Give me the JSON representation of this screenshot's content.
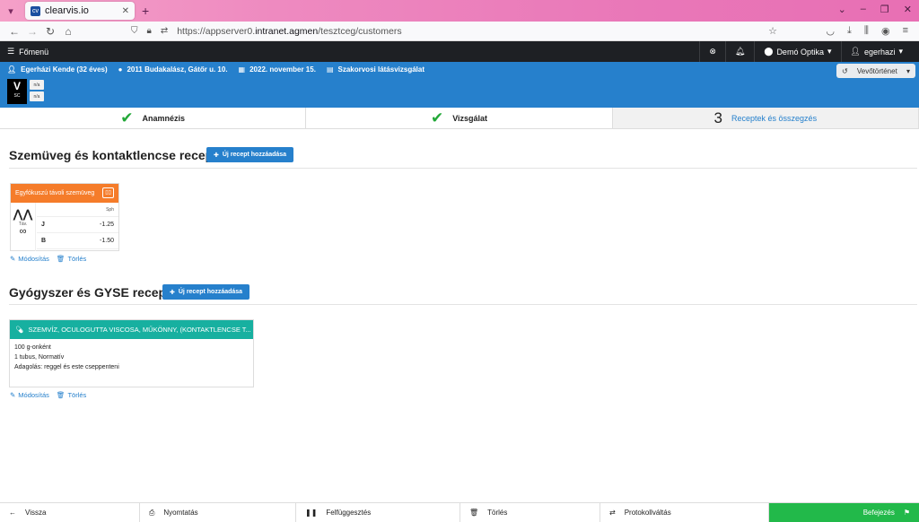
{
  "browser": {
    "tab_title": "clearvis.io",
    "favicon_text": "cv",
    "url_prefix": "https://appserver0.",
    "url_host": "intranet.agmen",
    "url_path": "/tesztceg/customers"
  },
  "appbar": {
    "menu_label": "Főmenü",
    "location": "Demó Optika",
    "user": "egerhazi"
  },
  "patient": {
    "name": "Egerházi Kende (32 éves)",
    "address": "2011 Budakalász, Gátőr u. 10.",
    "date": "2022. november 15.",
    "exam_type": "Szakorvosi látásvizsgálat",
    "history_button": "Vevőtörténet",
    "logo_big": "V",
    "logo_small": "SC",
    "na1": "n/a",
    "na2": "n/a"
  },
  "steps": [
    {
      "label": "Anamnézis"
    },
    {
      "label": "Vizsgálat"
    },
    {
      "num": "3",
      "label": "Receptek és összegzés"
    }
  ],
  "glasses_section": {
    "title": "Szemüveg és kontaktlencse receptek",
    "add_button": "Új recept hozzáadása",
    "card": {
      "header": "Egyfókuszú távoli szemüveg",
      "distance_label": "Táv.",
      "column_header": "Sph",
      "rows": [
        {
          "eye": "J",
          "sph": "-1.25"
        },
        {
          "eye": "B",
          "sph": "-1.50"
        }
      ]
    },
    "edit_link": "Módosítás",
    "delete_link": "Törlés"
  },
  "medicine_section": {
    "title": "Gyógyszer és GYSE receptek",
    "add_button": "Új recept hozzáadása",
    "card": {
      "header": "SZEMVÍZ, OCULOGUTTA VISCOSA, MŰKÖNNY, (KONTAKTLENCSE T...",
      "line1": "100 g-onként",
      "line2": "1 tubus, Normatív",
      "line3": "Adagolás: reggel és este cseppenteni"
    },
    "edit_link": "Módosítás",
    "delete_link": "Törlés"
  },
  "bottombar": {
    "back": "Vissza",
    "print": "Nyomtatás",
    "suspend": "Felfüggesztés",
    "delete": "Törlés",
    "protocol": "Protokollváltás",
    "finish": "Befejezés"
  },
  "colors": {
    "primary": "#2680cc",
    "success": "#22b94a",
    "orange": "#f57c2a",
    "teal": "#17b0a0"
  }
}
